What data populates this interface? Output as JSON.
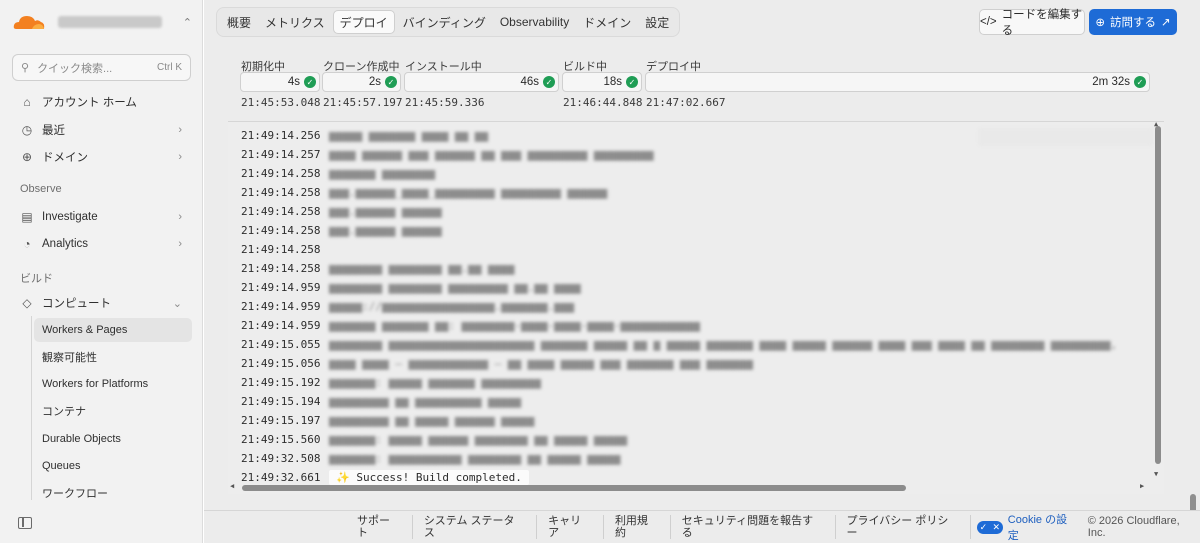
{
  "sidebar": {
    "search_placeholder": "クイック検索...",
    "search_shortcut": "Ctrl K",
    "top_items": [
      {
        "label": "アカウント ホーム"
      },
      {
        "label": "最近"
      },
      {
        "label": "ドメイン"
      }
    ],
    "section_observe": "Observe",
    "observe_items": [
      {
        "label": "Investigate"
      },
      {
        "label": "Analytics"
      }
    ],
    "section_build": "ビルド",
    "compute_label": "コンピュート",
    "compute_items": [
      {
        "label": "Workers & Pages"
      },
      {
        "label": "観察可能性"
      },
      {
        "label": "Workers for Platforms"
      },
      {
        "label": "コンテナ"
      },
      {
        "label": "Durable Objects"
      },
      {
        "label": "Queues"
      },
      {
        "label": "ワークフロー"
      }
    ]
  },
  "tabs": [
    "概要",
    "メトリクス",
    "デプロイ",
    "バインディング",
    "Observability",
    "ドメイン",
    "設定"
  ],
  "active_tab": "デプロイ",
  "actions": {
    "edit_code": "コードを編集する",
    "visit": "訪問する"
  },
  "stages": [
    {
      "label": "初期化中",
      "duration": "4s",
      "time": "21:45:53.048"
    },
    {
      "label": "クローン作成中",
      "duration": "2s",
      "time": "21:45:57.197"
    },
    {
      "label": "インストール中",
      "duration": "46s",
      "time": "21:45:59.336"
    },
    {
      "label": "ビルド中",
      "duration": "18s",
      "time": "21:46:44.848"
    },
    {
      "label": "デプロイ中",
      "duration": "2m 32s",
      "time": "21:47:02.667"
    }
  ],
  "log": {
    "rows": [
      {
        "ts": "21:49:14.256"
      },
      {
        "ts": "21:49:14.257"
      },
      {
        "ts": "21:49:14.258"
      },
      {
        "ts": "21:49:14.258"
      },
      {
        "ts": "21:49:14.258"
      },
      {
        "ts": "21:49:14.258"
      },
      {
        "ts": "21:49:14.258"
      },
      {
        "ts": "21:49:14.258"
      },
      {
        "ts": "21:49:14.959"
      },
      {
        "ts": "21:49:14.959"
      },
      {
        "ts": "21:49:14.959"
      },
      {
        "ts": "21:49:15.055"
      },
      {
        "ts": "21:49:15.056"
      },
      {
        "ts": "21:49:15.192"
      },
      {
        "ts": "21:49:15.194"
      },
      {
        "ts": "21:49:15.197"
      },
      {
        "ts": "21:49:15.560"
      },
      {
        "ts": "21:49:32.508"
      },
      {
        "ts": "21:49:32.661"
      }
    ],
    "last_message": "✨ Success! Build completed."
  },
  "footer": {
    "links": [
      "サポート",
      "システム ステータス",
      "キャリア",
      "利用規約",
      "セキュリティ問題を報告する",
      "プライバシー ポリシー"
    ],
    "cookie": "Cookie の設定",
    "copyright": "© 2026 Cloudflare, Inc."
  },
  "colors": {
    "accent": "#1e6bd6",
    "success": "#1f9d55",
    "brand_orange": "#f38020"
  }
}
